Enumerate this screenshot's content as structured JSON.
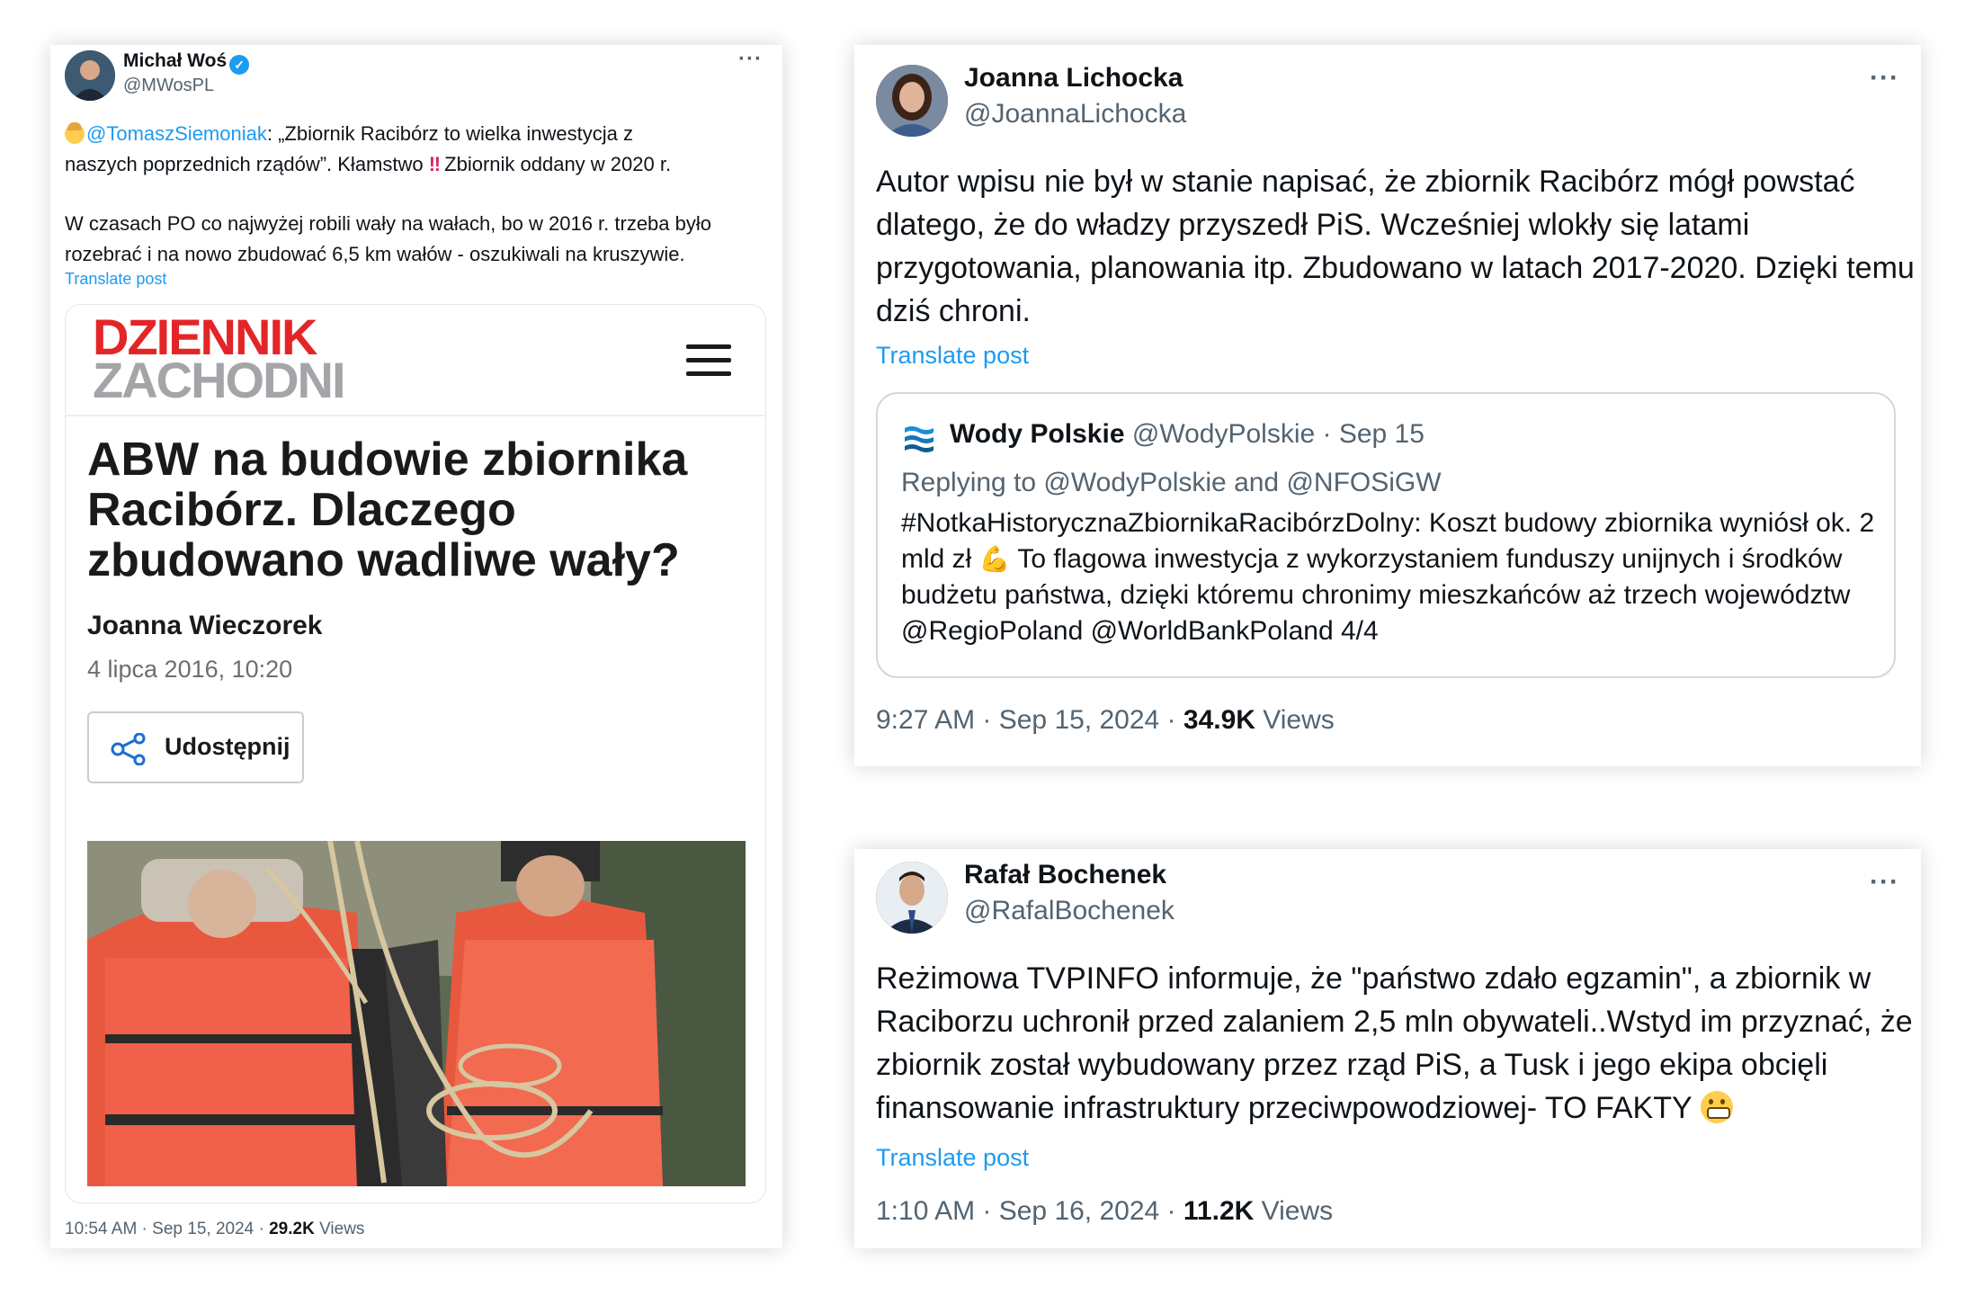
{
  "tweet_left": {
    "name": "Michał Woś",
    "handle": "@MWosPL",
    "text_line1_mention": "@TomaszSiemoniak",
    "text_line1_rest": ": „Zbiornik Racibórz to wielka inwestycja z",
    "text_line2_a": "naszych poprzednich rządów”. Kłamstwo ",
    "text_line2_emoji": "‼",
    "text_line2_b": " Zbiornik oddany w 2020 r.",
    "text_para2_line1": "W czasach PO co najwyżej robili wały na wałach, bo w 2016 r. trzeba było",
    "text_para2_line2": "rozebrać i na nowo zbudować 6,5 km wałów - oszukiwali na kruszywie.",
    "translate": "Translate post",
    "article": {
      "logo_top": "DZIENNIK",
      "logo_bottom": "ZACHODNI",
      "title": "ABW na budowie zbiornika Racibórz. Dlaczego zbudowano wadliwe wały?",
      "author": "Joanna Wieczorek",
      "date": "4 lipca 2016, 10:20",
      "share": "Udostępnij"
    },
    "footer_time": "10:54 AM · Sep 15, 2024 · ",
    "footer_views_num": "29.2K",
    "footer_views_label": " Views"
  },
  "tweet_joanna": {
    "name": "Joanna Lichocka",
    "handle": "@JoannaLichocka",
    "body": "Autor wpisu nie był w stanie napisać, że zbiornik Racibórz mógł powstać dlatego, że do władzy przyszedł PiS. Wcześniej wlokły się latami przygotowania, planowania  itp. Zbudowano w latach 2017-2020. Dzięki temu dziś chroni.",
    "translate": "Translate post",
    "quote": {
      "name": "Wody Polskie",
      "handle_date": "@WodyPolskie · Sep 15",
      "replying": "Replying to @WodyPolskie and @NFOSiGW",
      "body_a": "#NotkaHistorycznaZbiornikaRacibórzDolny: Koszt budowy zbiornika wyniósł ok. 2 mld zł ",
      "body_emoji": "💪",
      "body_b": " To flagowa inwestycja z wykorzystaniem funduszy unijnych i środków budżetu państwa, dzięki któremu chronimy mieszkańców aż trzech województw @RegioPoland @WorldBankPoland  4/4"
    },
    "footer_time": "9:27 AM · Sep 15, 2024 · ",
    "footer_views_num": "34.9K",
    "footer_views_label": " Views"
  },
  "tweet_rafal": {
    "name": "Rafał Bochenek",
    "handle": "@RafalBochenek",
    "body": "Reżimowa TVPINFO informuje, że \"państwo zdało egzamin\", a zbiornik w Raciborzu uchronił przed zalaniem 2,5 mln obywateli..Wstyd im przyznać, że zbiornik został wybudowany przez rząd PiS, a Tusk i jego ekipa obcięli finansowanie infrastruktury przeciwpowodziowej- TO FAKTY ",
    "translate": "Translate post",
    "footer_time": "1:10 AM · Sep 16, 2024 · ",
    "footer_views_num": "11.2K",
    "footer_views_label": " Views"
  },
  "more_label": "···",
  "colors": {
    "link": "#1d9bf0",
    "muted": "#536471",
    "logo_red": "#e42528",
    "logo_grey": "#a3a5a8"
  }
}
